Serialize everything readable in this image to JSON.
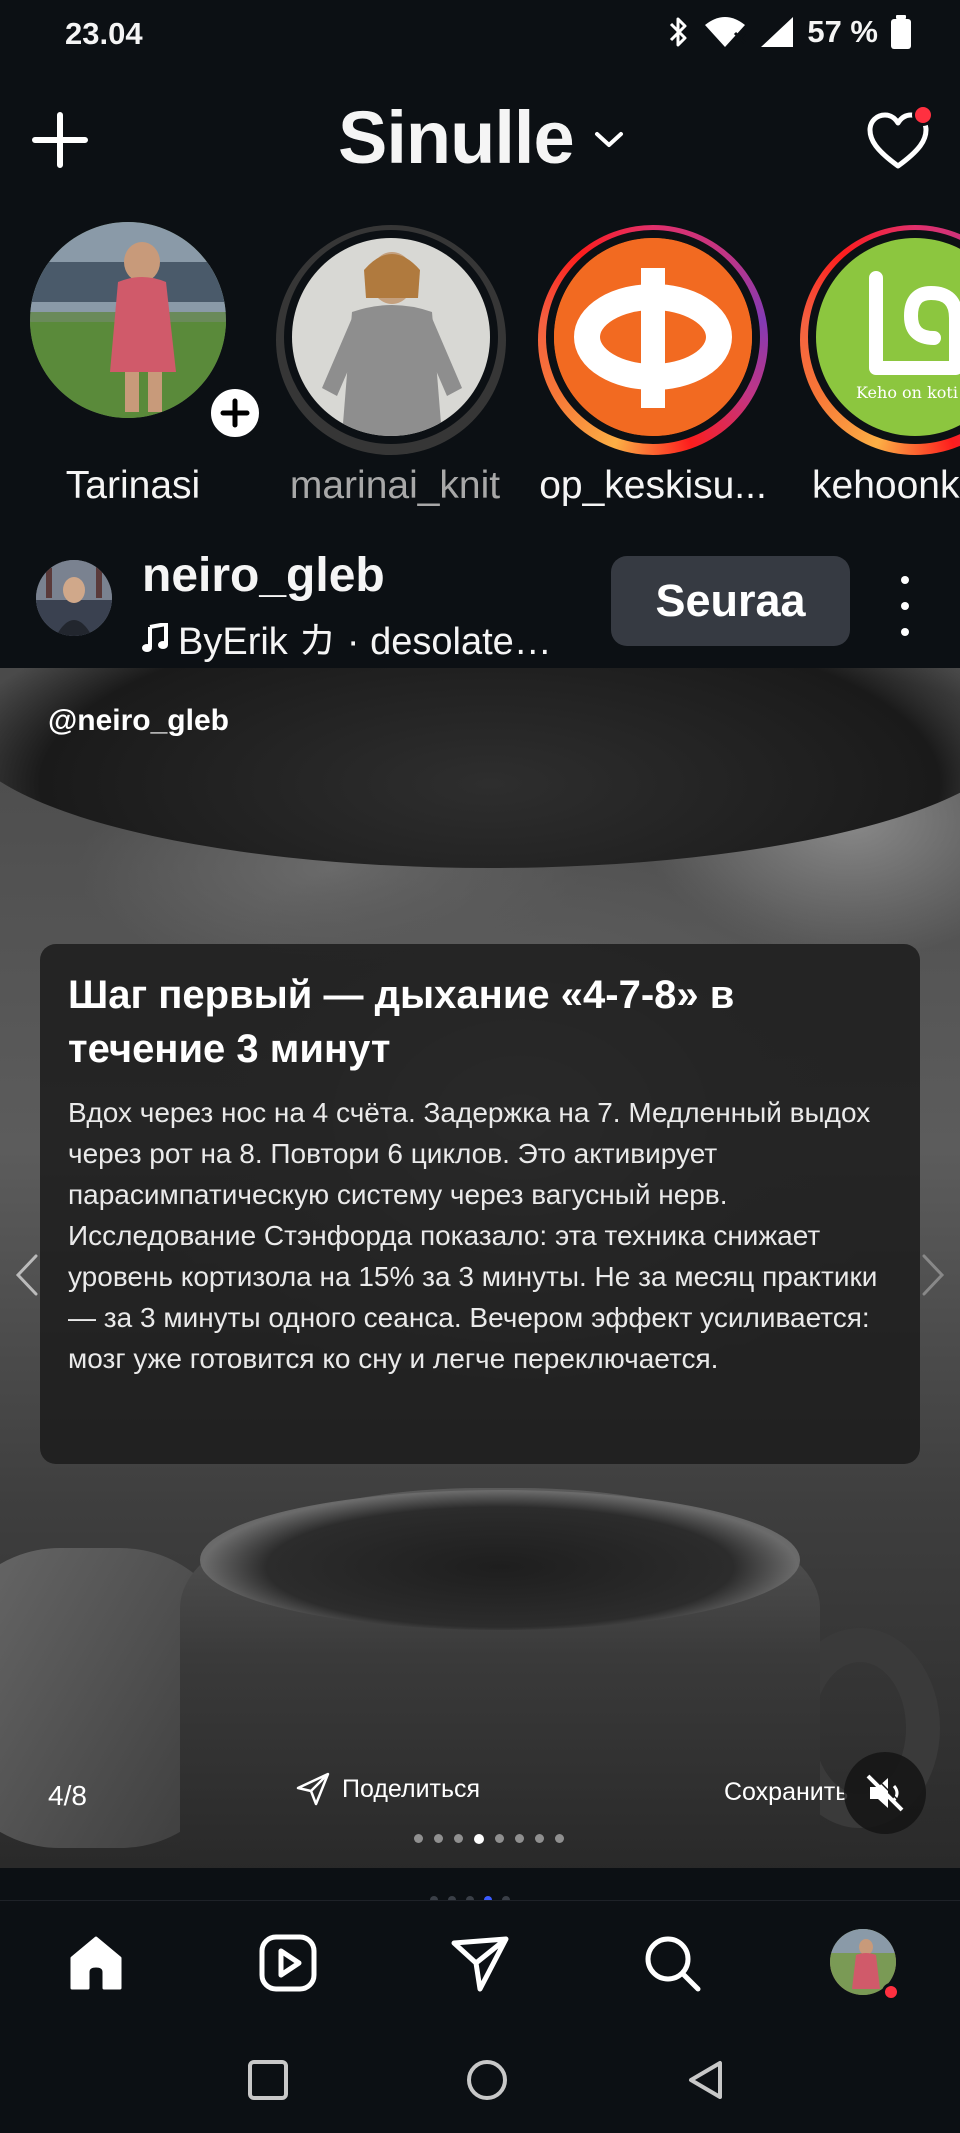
{
  "status_bar": {
    "time": "23.04",
    "battery_percent": "57 %",
    "icons": [
      "bluetooth-icon",
      "wifi-icon",
      "signal-icon",
      "battery-icon"
    ]
  },
  "header": {
    "title": "Sinulle",
    "has_notification": true
  },
  "stories": [
    {
      "label": "Tarinasi",
      "seen": true,
      "own": true
    },
    {
      "label": "marinai_knit",
      "seen": true,
      "own": false
    },
    {
      "label": "op_keskisu...",
      "seen": false,
      "own": false
    },
    {
      "label": "kehoonk",
      "seen": false,
      "own": false
    }
  ],
  "story_logos": {
    "op_mark": "OP",
    "keho_text": "Keho on koti®"
  },
  "post": {
    "username": "neiro_gleb",
    "audio": "ByErik カ · desolate…",
    "follow_label": "Seuraa",
    "media_tag": "@neiro_gleb",
    "card_title": "Шаг первый — дыхание «4-7-8» в течение 3 минут",
    "card_body": "Вдох через нос на 4 счёта. Задержка на 7. Медленный выдох через рот на 8. Повтори 6 циклов. Это активирует парасимпатическую систему через вагусный нерв. Исследование Стэнфорда показало: эта техника снижает уровень кортизола на 15% за 3 минуты. Не за месяц практики — за 3 минуты одного сеанса. Вечером эффект усиливается: мозг уже готовится ко сну и легче переключается.",
    "counter": "4/8",
    "share_label": "Поделиться",
    "save_label": "Сохранить",
    "current_slide": 4,
    "total_slides": 8
  },
  "bottom_nav": {
    "items": [
      "home-icon",
      "reels-icon",
      "direct-icon",
      "search-icon",
      "profile-avatar"
    ],
    "active": "home-icon"
  },
  "colors": {
    "background": "#0c1014",
    "follow_button": "#363a42",
    "notification": "#ff3040",
    "op_orange": "#f26a21",
    "keho_green": "#8cc63f"
  }
}
